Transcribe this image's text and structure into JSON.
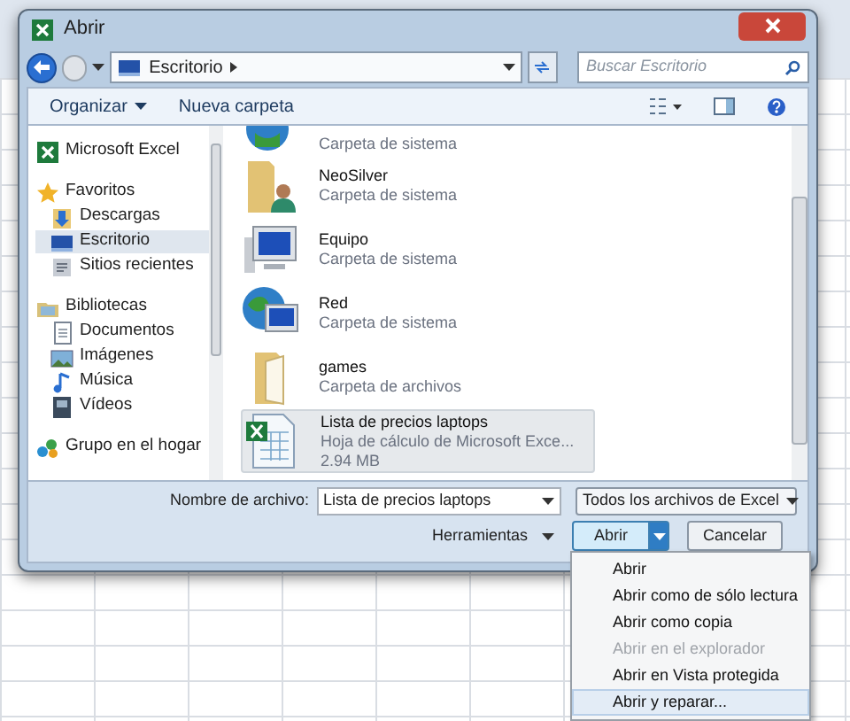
{
  "dialog": {
    "title": "Abrir",
    "address": {
      "path": "Escritorio"
    },
    "search": {
      "placeholder": "Buscar Escritorio"
    },
    "toolbar": [
      {
        "label": "Organizar",
        "has_menu": true
      },
      {
        "label": "Nueva carpeta",
        "has_menu": false
      }
    ],
    "sidebar": [
      {
        "label": "Microsoft Excel",
        "kind": "excel",
        "selected": false
      },
      {
        "label": "Favoritos",
        "kind": "star",
        "selected": false,
        "children": [
          {
            "label": "Descargas",
            "kind": "download",
            "selected": false
          },
          {
            "label": "Escritorio",
            "kind": "desktop",
            "selected": true
          },
          {
            "label": "Sitios recientes",
            "kind": "recent",
            "selected": false
          }
        ]
      },
      {
        "label": "Bibliotecas",
        "kind": "library",
        "selected": false,
        "children": [
          {
            "label": "Documentos",
            "kind": "document",
            "selected": false
          },
          {
            "label": "Imágenes",
            "kind": "image",
            "selected": false
          },
          {
            "label": "Música",
            "kind": "music",
            "selected": false
          },
          {
            "label": "Vídeos",
            "kind": "video",
            "selected": false
          }
        ]
      },
      {
        "label": "Grupo en el hogar",
        "kind": "homegroup",
        "selected": false
      }
    ],
    "files": [
      {
        "kind": "globe",
        "type": "Carpeta de sistema",
        "selected": false
      },
      {
        "kind": "user",
        "name": "NeoSilver",
        "type": "Carpeta de sistema",
        "selected": false
      },
      {
        "kind": "computer",
        "name": "Equipo",
        "type": "Carpeta de sistema",
        "selected": false
      },
      {
        "kind": "network",
        "name": "Red",
        "type": "Carpeta de sistema",
        "selected": false
      },
      {
        "kind": "folder",
        "name": "games",
        "type": "Carpeta de archivos",
        "selected": false
      },
      {
        "kind": "excel",
        "name": "Lista de precios laptops",
        "type": "Hoja de cálculo de Microsoft Exce...",
        "size": "2.94 MB",
        "selected": true
      }
    ],
    "filename_label": "Nombre de archivo:",
    "filename": "Lista de precios laptops",
    "filter": "Todos los archivos de Excel",
    "tools": "Herramientas",
    "open": "Abrir",
    "cancel": "Cancelar"
  },
  "open_menu": [
    {
      "label": "Abrir",
      "disabled": false,
      "selected": false
    },
    {
      "label": "Abrir como de sólo lectura",
      "disabled": false,
      "selected": false
    },
    {
      "label": "Abrir como copia",
      "disabled": false,
      "selected": false
    },
    {
      "label": "Abrir en el explorador",
      "disabled": true,
      "selected": false
    },
    {
      "label": "Abrir en Vista protegida",
      "disabled": false,
      "selected": false
    },
    {
      "label": "Abrir y reparar...",
      "disabled": false,
      "selected": true
    }
  ]
}
